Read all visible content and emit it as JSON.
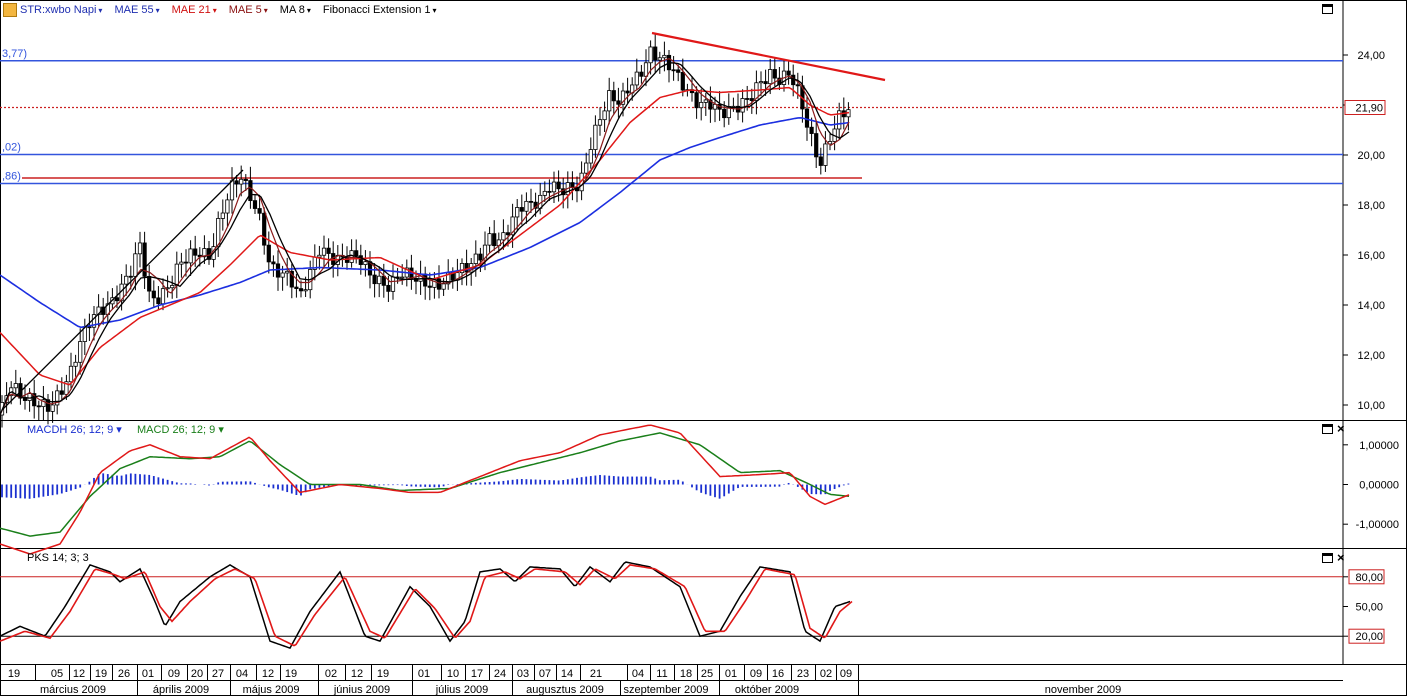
{
  "toolbar": {
    "symbol": "STR:xwbo Napi",
    "items": [
      {
        "label": "MAE 55",
        "color": "#1f2fb0"
      },
      {
        "label": "MAE 21",
        "color": "#d01010"
      },
      {
        "label": "MAE 5",
        "color": "#8a1010"
      },
      {
        "label": "MA 8",
        "color": "#000000"
      },
      {
        "label": "Fibonacci Extension 1",
        "color": "#000000"
      }
    ]
  },
  "colors": {
    "ma55": "#1c2fe0",
    "mae21": "#e01818",
    "mae5": "#8b1a1a",
    "ma8": "#000000",
    "fib": "#3355dd",
    "trend": "#e01818",
    "macd": "#e01818",
    "signal": "#1a7f1a",
    "hist": "#1a2fd0",
    "stoch_k": "#000000",
    "stoch_d": "#e01818"
  },
  "chart_data": {
    "type": "candlestick",
    "title": "STR:xwbo Napi",
    "price_axis": {
      "ylim": [
        9.4,
        25.4
      ],
      "ticks": [
        "24,00",
        "22,00",
        "20,00",
        "18,00",
        "16,00",
        "14,00",
        "12,00",
        "10,00"
      ],
      "last_price_label": "21,90"
    },
    "fib_labels": [
      "3,77)",
      ",02)",
      ",86)"
    ],
    "fib_levels": [
      23.77,
      20.02,
      18.86
    ],
    "red_levels": [
      21.9,
      19.08
    ],
    "trendline": {
      "from": [
        "03 szeptember 2009",
        24.6
      ],
      "to": [
        "16 október 2009",
        23.5
      ]
    },
    "support_line": {
      "from": [
        "19 február 2009",
        9.8
      ],
      "to": [
        "04 május 2009",
        19.4
      ]
    },
    "price_keypoints": [
      [
        0,
        9.6
      ],
      [
        10,
        10.9
      ],
      [
        20,
        10.4
      ],
      [
        30,
        10.2
      ],
      [
        40,
        10.0
      ],
      [
        50,
        9.9
      ],
      [
        60,
        10.5
      ],
      [
        70,
        11.2
      ],
      [
        80,
        12.5
      ],
      [
        90,
        13.4
      ],
      [
        100,
        13.8
      ],
      [
        110,
        14.0
      ],
      [
        120,
        14.6
      ],
      [
        130,
        15.3
      ],
      [
        140,
        16.4
      ],
      [
        150,
        14.2
      ],
      [
        160,
        14.3
      ],
      [
        170,
        14.8
      ],
      [
        180,
        15.7
      ],
      [
        190,
        16.0
      ],
      [
        200,
        16.1
      ],
      [
        210,
        15.9
      ],
      [
        220,
        17.5
      ],
      [
        230,
        18.6
      ],
      [
        240,
        19.2
      ],
      [
        250,
        18.4
      ],
      [
        260,
        17.4
      ],
      [
        270,
        15.5
      ],
      [
        280,
        15.3
      ],
      [
        290,
        15.1
      ],
      [
        300,
        14.3
      ],
      [
        310,
        15.3
      ],
      [
        320,
        16.3
      ],
      [
        330,
        15.9
      ],
      [
        340,
        15.8
      ],
      [
        350,
        16.0
      ],
      [
        360,
        15.9
      ],
      [
        370,
        15.2
      ],
      [
        380,
        14.9
      ],
      [
        390,
        14.7
      ],
      [
        400,
        15.3
      ],
      [
        410,
        15.2
      ],
      [
        420,
        15.0
      ],
      [
        430,
        14.8
      ],
      [
        440,
        14.8
      ],
      [
        450,
        15.1
      ],
      [
        460,
        15.4
      ],
      [
        470,
        15.6
      ],
      [
        480,
        16.0
      ],
      [
        490,
        16.7
      ],
      [
        500,
        16.5
      ],
      [
        510,
        17.2
      ],
      [
        520,
        18.0
      ],
      [
        530,
        18.0
      ],
      [
        540,
        18.2
      ],
      [
        550,
        18.8
      ],
      [
        560,
        18.6
      ],
      [
        570,
        18.7
      ],
      [
        580,
        18.8
      ],
      [
        590,
        20.3
      ],
      [
        600,
        21.5
      ],
      [
        610,
        22.4
      ],
      [
        620,
        22.1
      ],
      [
        630,
        22.8
      ],
      [
        640,
        23.2
      ],
      [
        650,
        24.1
      ],
      [
        660,
        23.9
      ],
      [
        670,
        23.6
      ],
      [
        680,
        23.0
      ],
      [
        690,
        22.4
      ],
      [
        700,
        22.0
      ],
      [
        710,
        22.1
      ],
      [
        720,
        21.7
      ],
      [
        730,
        21.8
      ],
      [
        740,
        22.0
      ],
      [
        750,
        22.3
      ],
      [
        760,
        22.9
      ],
      [
        770,
        23.2
      ],
      [
        780,
        23.0
      ],
      [
        790,
        23.3
      ],
      [
        800,
        22.3
      ],
      [
        810,
        20.8
      ],
      [
        820,
        19.6
      ],
      [
        830,
        20.7
      ],
      [
        840,
        21.6
      ],
      [
        850,
        21.9
      ]
    ],
    "ma55_keypoints": [
      [
        0,
        15.2
      ],
      [
        40,
        14.1
      ],
      [
        80,
        13.1
      ],
      [
        120,
        13.4
      ],
      [
        160,
        14.0
      ],
      [
        200,
        14.4
      ],
      [
        240,
        14.9
      ],
      [
        270,
        15.4
      ],
      [
        320,
        15.5
      ],
      [
        380,
        15.4
      ],
      [
        430,
        15.2
      ],
      [
        480,
        15.5
      ],
      [
        530,
        16.3
      ],
      [
        580,
        17.3
      ],
      [
        620,
        18.5
      ],
      [
        660,
        19.8
      ],
      [
        690,
        20.3
      ],
      [
        720,
        20.7
      ],
      [
        760,
        21.2
      ],
      [
        800,
        21.5
      ],
      [
        830,
        21.2
      ],
      [
        850,
        21.3
      ]
    ],
    "mae21_keypoints": [
      [
        0,
        12.9
      ],
      [
        40,
        11.2
      ],
      [
        70,
        10.8
      ],
      [
        100,
        12.3
      ],
      [
        140,
        13.5
      ],
      [
        170,
        14.0
      ],
      [
        200,
        14.5
      ],
      [
        230,
        15.6
      ],
      [
        260,
        16.8
      ],
      [
        290,
        16.1
      ],
      [
        330,
        15.8
      ],
      [
        380,
        15.9
      ],
      [
        430,
        15.0
      ],
      [
        480,
        15.6
      ],
      [
        520,
        16.8
      ],
      [
        560,
        18.0
      ],
      [
        600,
        19.8
      ],
      [
        630,
        21.3
      ],
      [
        660,
        22.3
      ],
      [
        690,
        22.6
      ],
      [
        720,
        22.5
      ],
      [
        760,
        22.6
      ],
      [
        790,
        22.7
      ],
      [
        810,
        22.0
      ],
      [
        830,
        21.6
      ],
      [
        850,
        21.7
      ]
    ],
    "macd": {
      "ylim": [
        -1.6,
        1.6
      ],
      "ticks": [
        "1,00000",
        "0,00000",
        "-1,00000"
      ],
      "label_macdh": "MACDH 26; 12; 9",
      "label_macd": "MACD 26; 12; 9",
      "macd_keypoints": [
        [
          0,
          -1.5
        ],
        [
          30,
          -1.75
        ],
        [
          60,
          -1.5
        ],
        [
          80,
          -0.7
        ],
        [
          100,
          0.3
        ],
        [
          130,
          0.85
        ],
        [
          150,
          1.0
        ],
        [
          180,
          0.7
        ],
        [
          210,
          0.65
        ],
        [
          250,
          1.2
        ],
        [
          270,
          0.6
        ],
        [
          300,
          -0.2
        ],
        [
          340,
          0.0
        ],
        [
          380,
          -0.1
        ],
        [
          410,
          -0.2
        ],
        [
          440,
          -0.2
        ],
        [
          480,
          0.2
        ],
        [
          520,
          0.6
        ],
        [
          560,
          0.8
        ],
        [
          600,
          1.25
        ],
        [
          650,
          1.5
        ],
        [
          680,
          1.3
        ],
        [
          720,
          0.2
        ],
        [
          760,
          0.25
        ],
        [
          790,
          0.3
        ],
        [
          810,
          -0.3
        ],
        [
          825,
          -0.5
        ],
        [
          850,
          -0.25
        ]
      ],
      "signal_keypoints": [
        [
          0,
          -1.1
        ],
        [
          30,
          -1.3
        ],
        [
          60,
          -1.2
        ],
        [
          90,
          -0.3
        ],
        [
          120,
          0.4
        ],
        [
          150,
          0.7
        ],
        [
          190,
          0.65
        ],
        [
          220,
          0.7
        ],
        [
          250,
          1.1
        ],
        [
          280,
          0.5
        ],
        [
          310,
          0.0
        ],
        [
          360,
          0.0
        ],
        [
          400,
          -0.15
        ],
        [
          450,
          -0.1
        ],
        [
          500,
          0.3
        ],
        [
          540,
          0.55
        ],
        [
          580,
          0.8
        ],
        [
          620,
          1.1
        ],
        [
          660,
          1.3
        ],
        [
          700,
          1.0
        ],
        [
          740,
          0.3
        ],
        [
          780,
          0.35
        ],
        [
          810,
          0.0
        ],
        [
          830,
          -0.25
        ],
        [
          850,
          -0.3
        ]
      ]
    },
    "stoch": {
      "label": "PKS 14; 3; 3",
      "ylim": [
        0,
        100
      ],
      "ticks": [
        "80,00",
        "50,00",
        "20,00"
      ],
      "k_keypoints": [
        [
          0,
          20
        ],
        [
          20,
          30
        ],
        [
          45,
          20
        ],
        [
          65,
          50
        ],
        [
          90,
          92
        ],
        [
          110,
          85
        ],
        [
          120,
          75
        ],
        [
          140,
          88
        ],
        [
          155,
          55
        ],
        [
          165,
          30
        ],
        [
          180,
          55
        ],
        [
          210,
          80
        ],
        [
          230,
          92
        ],
        [
          250,
          80
        ],
        [
          270,
          15
        ],
        [
          290,
          8
        ],
        [
          310,
          45
        ],
        [
          340,
          85
        ],
        [
          365,
          20
        ],
        [
          380,
          15
        ],
        [
          410,
          70
        ],
        [
          430,
          50
        ],
        [
          450,
          15
        ],
        [
          465,
          35
        ],
        [
          480,
          85
        ],
        [
          500,
          88
        ],
        [
          515,
          75
        ],
        [
          530,
          90
        ],
        [
          560,
          88
        ],
        [
          575,
          70
        ],
        [
          590,
          90
        ],
        [
          610,
          75
        ],
        [
          625,
          95
        ],
        [
          650,
          90
        ],
        [
          680,
          70
        ],
        [
          700,
          20
        ],
        [
          720,
          25
        ],
        [
          740,
          60
        ],
        [
          760,
          90
        ],
        [
          790,
          85
        ],
        [
          805,
          25
        ],
        [
          820,
          15
        ],
        [
          835,
          50
        ],
        [
          850,
          55
        ]
      ],
      "d_keypoints": [
        [
          0,
          15
        ],
        [
          25,
          25
        ],
        [
          50,
          18
        ],
        [
          70,
          45
        ],
        [
          95,
          88
        ],
        [
          115,
          82
        ],
        [
          125,
          78
        ],
        [
          145,
          85
        ],
        [
          160,
          50
        ],
        [
          172,
          35
        ],
        [
          190,
          55
        ],
        [
          215,
          78
        ],
        [
          235,
          88
        ],
        [
          255,
          78
        ],
        [
          275,
          20
        ],
        [
          295,
          10
        ],
        [
          315,
          42
        ],
        [
          345,
          80
        ],
        [
          370,
          25
        ],
        [
          385,
          18
        ],
        [
          415,
          68
        ],
        [
          435,
          48
        ],
        [
          455,
          18
        ],
        [
          470,
          35
        ],
        [
          485,
          80
        ],
        [
          505,
          85
        ],
        [
          520,
          78
        ],
        [
          535,
          88
        ],
        [
          565,
          85
        ],
        [
          580,
          72
        ],
        [
          595,
          88
        ],
        [
          615,
          78
        ],
        [
          630,
          92
        ],
        [
          655,
          88
        ],
        [
          685,
          70
        ],
        [
          705,
          25
        ],
        [
          725,
          25
        ],
        [
          745,
          55
        ],
        [
          765,
          88
        ],
        [
          795,
          82
        ],
        [
          810,
          28
        ],
        [
          825,
          18
        ],
        [
          840,
          45
        ],
        [
          852,
          55
        ]
      ]
    },
    "x_axis": {
      "day_ticks": [
        "19",
        "05",
        "12",
        "19",
        "26",
        "01",
        "09",
        "20",
        "27",
        "04",
        "12",
        "19",
        "02",
        "12",
        "19",
        "01",
        "10",
        "17",
        "24",
        "03",
        "07",
        "14",
        "21",
        "04",
        "11",
        "18",
        "25",
        "01",
        "09",
        "16",
        "23",
        "02",
        "09"
      ],
      "months": [
        "március 2009",
        "április 2009",
        "május 2009",
        "június 2009",
        "július 2009",
        "augusztus 2009",
        "szeptember 2009",
        "október 2009",
        "november 2009"
      ]
    }
  }
}
